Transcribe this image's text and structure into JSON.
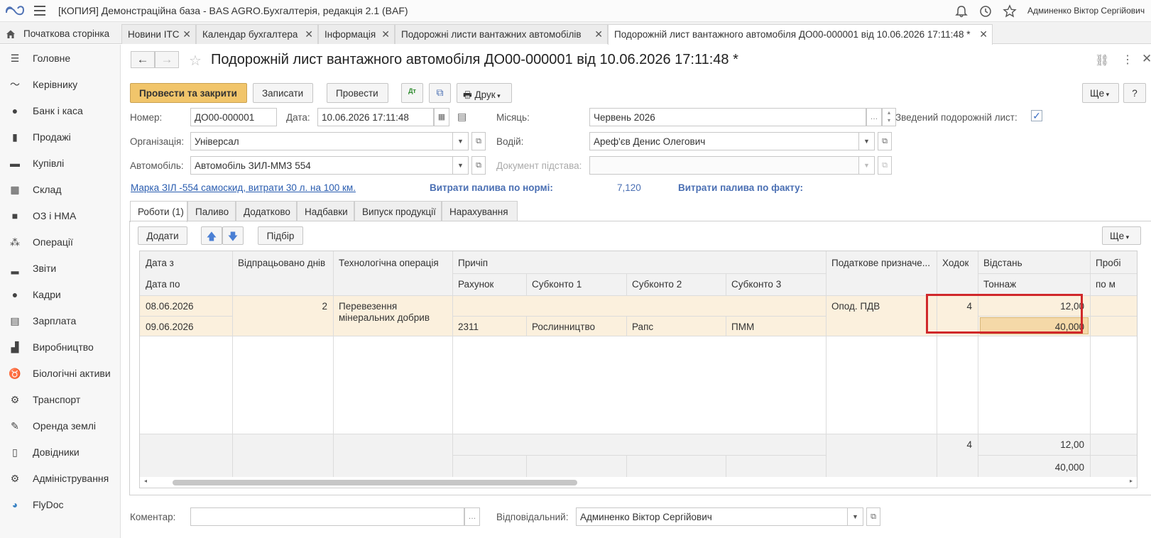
{
  "app": {
    "title": "[КОПИЯ] Демонстраційна база - BAS AGRO.Бухгалтерія, редакція 2.1  (BAF)",
    "user": "Админенко Віктор Сергійович"
  },
  "tabs": {
    "home": "Початкова сторінка",
    "items": [
      {
        "label": "Новини ІТС"
      },
      {
        "label": "Календар бухгалтера"
      },
      {
        "label": "Інформація"
      },
      {
        "label": "Подорожні листи вантажних автомобілів"
      },
      {
        "label": "Подорожній лист вантажного автомобіля ДО00-000001 від 10.06.2026 17:11:48 *"
      }
    ]
  },
  "sidebar": {
    "items": [
      {
        "label": "Головне",
        "icon": "menu-lines-icon"
      },
      {
        "label": "Керівнику",
        "icon": "trend-icon"
      },
      {
        "label": "Банк і каса",
        "icon": "coins-icon"
      },
      {
        "label": "Продажі",
        "icon": "bag-icon"
      },
      {
        "label": "Купівлі",
        "icon": "cart-icon"
      },
      {
        "label": "Склад",
        "icon": "warehouse-icon"
      },
      {
        "label": "ОЗ і НМА",
        "icon": "truck-icon"
      },
      {
        "label": "Операції",
        "icon": "operations-icon"
      },
      {
        "label": "Звіти",
        "icon": "bar-chart-icon"
      },
      {
        "label": "Кадри",
        "icon": "person-icon"
      },
      {
        "label": "Зарплата",
        "icon": "calculator-icon"
      },
      {
        "label": "Виробництво",
        "icon": "factory-icon"
      },
      {
        "label": "Біологічні активи",
        "icon": "cow-icon"
      },
      {
        "label": "Транспорт",
        "icon": "tractor-icon"
      },
      {
        "label": "Оренда землі",
        "icon": "feather-icon"
      },
      {
        "label": "Довідники",
        "icon": "book-icon"
      },
      {
        "label": "Адміністрування",
        "icon": "gear-icon"
      },
      {
        "label": "FlyDoc",
        "icon": "flydoc-icon"
      }
    ]
  },
  "document": {
    "title": "Подорожній лист вантажного автомобіля ДО00-000001 від 10.06.2026 17:11:48 *"
  },
  "toolbar": {
    "post_close": "Провести та закрити",
    "save": "Записати",
    "post": "Провести",
    "print": "Друк",
    "more": "Ще",
    "help": "?"
  },
  "form": {
    "number_label": "Номер:",
    "number": "ДО00-000001",
    "date_label": "Дата:",
    "date": "10.06.2026 17:11:48",
    "month_label": "Місяць:",
    "month": "Червень 2026",
    "summary_label": "Зведений подорожній лист:",
    "org_label": "Організація:",
    "org": "Універсал",
    "driver_label": "Водій:",
    "driver": "Ареф'єв Денис Олегович",
    "car_label": "Автомобіль:",
    "car": "Автомобіль ЗИЛ-ММЗ  554",
    "basis_label": "Документ підстава:",
    "basis": "",
    "brand_link": "Марка ЗІЛ -554 самоскид, витрати 30 л. на 100 км.",
    "fuel_norm_label": "Витрати палива по нормі:",
    "fuel_norm": "7,120",
    "fuel_fact_label": "Витрати палива по факту:",
    "comment_label": "Коментар:",
    "comment": "",
    "responsible_label": "Відповідальний:",
    "responsible": "Админенко Віктор Сергійович"
  },
  "form_tabs": [
    "Роботи (1)",
    "Паливо",
    "Додатково",
    "Надбавки",
    "Випуск продукції",
    "Нарахування"
  ],
  "table_toolbar": {
    "add": "Додати",
    "pick": "Підбір",
    "more": "Ще"
  },
  "table": {
    "headers": {
      "date_from": "Дата з",
      "date_to": "Дата по",
      "days": "Відпрацьовано днів",
      "operation": "Технологічна операція",
      "trailer": "Причіп",
      "account": "Рахунок",
      "sub1": "Субконто 1",
      "sub2": "Субконто 2",
      "sub3": "Субконто 3",
      "tax": "Податкове призначе...",
      "trips": "Ходок",
      "distance": "Відстань",
      "tonnage": "Тоннаж",
      "run": "Пробі",
      "run2": "по м"
    },
    "row": {
      "date_from": "08.06.2026",
      "date_to": "09.06.2026",
      "days": "2",
      "operation_l1": "Перевезення",
      "operation_l2": "мінеральних добрив",
      "account": "2311",
      "sub1": "Рослинництво",
      "sub2": "Рапс",
      "sub3": "ПММ",
      "tax": "Опод. ПДВ",
      "trips": "4",
      "distance": "12,00",
      "tonnage": "40,000"
    },
    "totals": {
      "trips": "4",
      "distance": "12,00",
      "tonnage": "40,000"
    }
  },
  "colors": {
    "primary_button": "#f1c56b",
    "row_highlight": "#fbf0dd",
    "selected_cell": "#f5d9a8",
    "highlight_border": "#d0282a",
    "link": "#2a5db0"
  }
}
